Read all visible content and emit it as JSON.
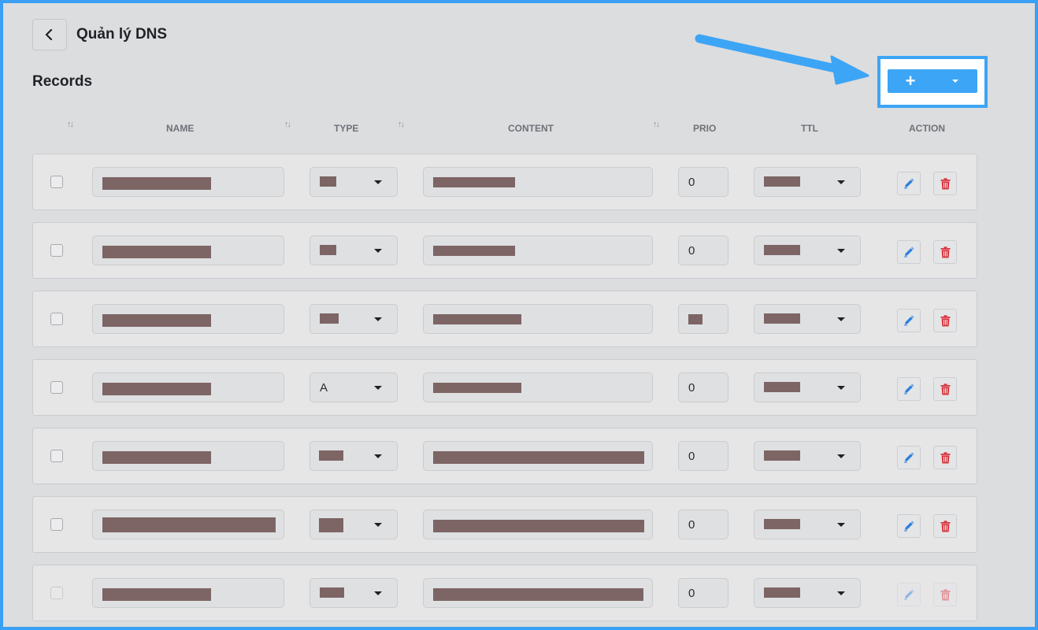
{
  "header": {
    "title": "Quản lý DNS"
  },
  "section": {
    "title": "Records"
  },
  "columns": {
    "name": "NAME",
    "type": "TYPE",
    "content": "CONTENT",
    "prio": "PRIO",
    "ttl": "TTL",
    "action": "ACTION"
  },
  "add_button": {
    "label": "+"
  },
  "colors": {
    "accent": "#3da5f5",
    "redaction": "#7d6565",
    "delete": "#d9363e",
    "edit": "#2f7fdc"
  },
  "rows": [
    {
      "type_text": "",
      "prio_text": "0"
    },
    {
      "type_text": "",
      "prio_text": "0"
    },
    {
      "type_text": "",
      "prio_text": ""
    },
    {
      "type_text": "A",
      "prio_text": "0"
    },
    {
      "type_text": "",
      "prio_text": "0"
    },
    {
      "type_text": "",
      "prio_text": "0"
    },
    {
      "type_text": "",
      "prio_text": "0"
    }
  ]
}
